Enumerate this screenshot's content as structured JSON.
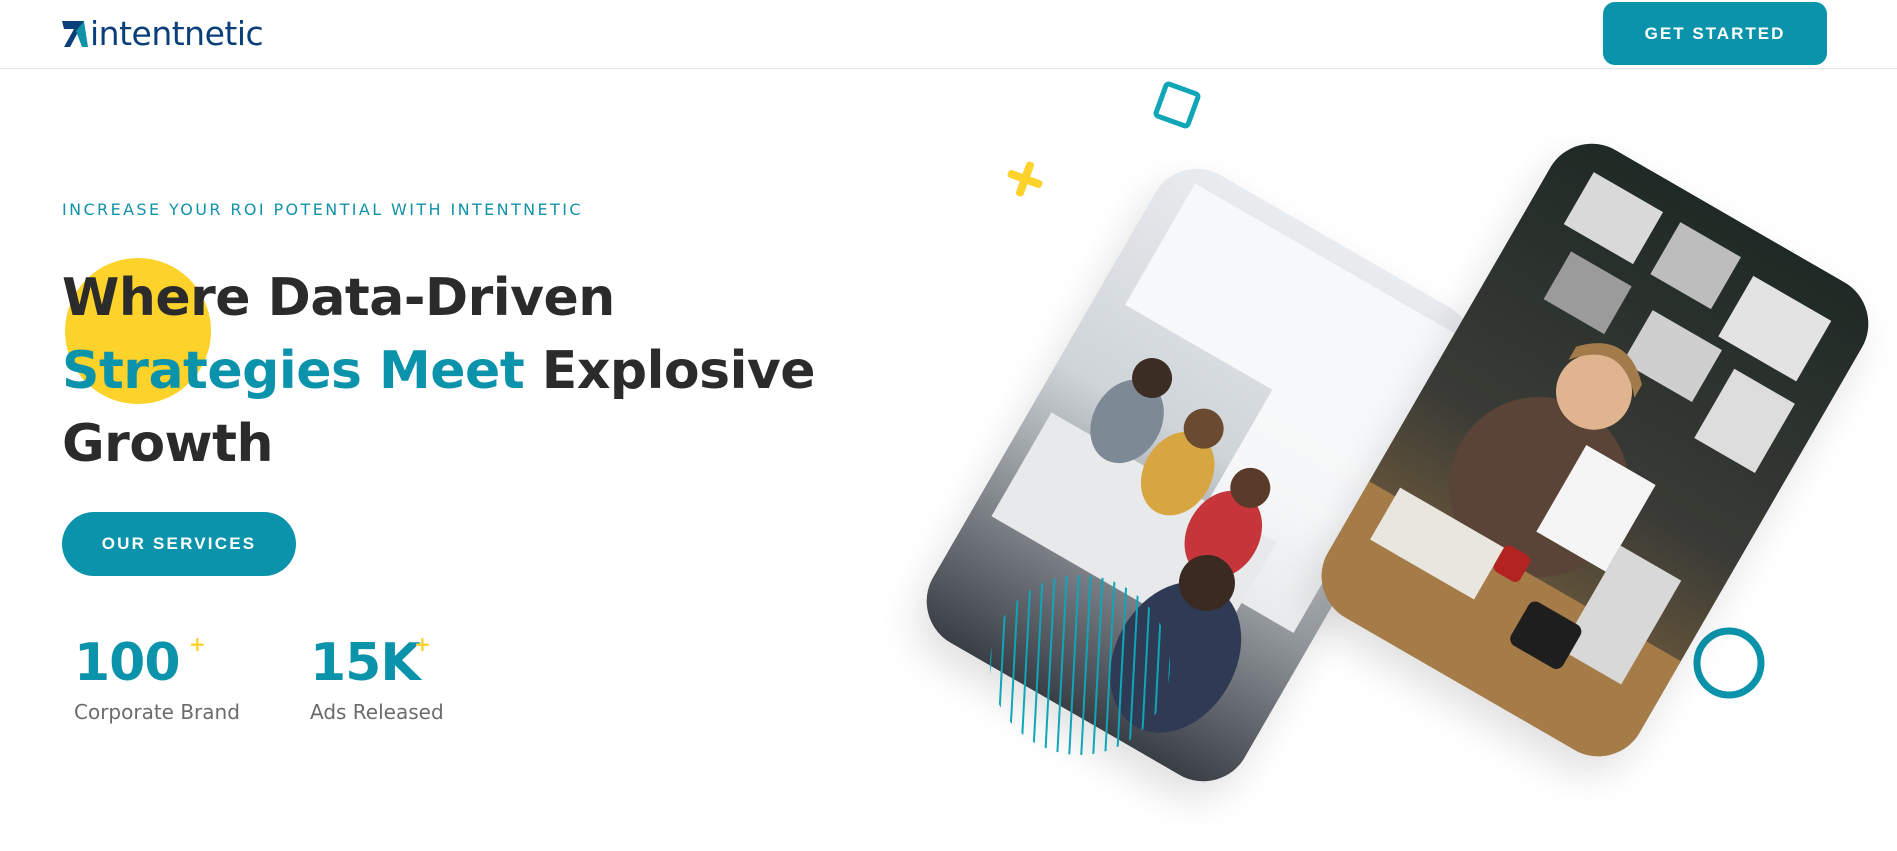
{
  "header": {
    "logo_text": "intentnetic",
    "cta_label": "GET STARTED"
  },
  "hero": {
    "tagline": "INCREASE YOUR ROI POTENTIAL WITH INTENTNETIC",
    "headline": {
      "line1": "Where Data-Driven",
      "line2_accent": "Strategies Meet",
      "line2_rest": " Explosive",
      "line3": "Growth"
    },
    "services_label": "OUR SERVICES"
  },
  "stats": [
    {
      "value": "100",
      "suffix": "+",
      "label": "Corporate Brand"
    },
    {
      "value": "15K",
      "suffix": "+",
      "label": "Ads Released"
    }
  ],
  "colors": {
    "primary": "#0a93aa",
    "accent_yellow": "#fcd22b",
    "logo_navy": "#0b3f7a",
    "text_dark": "#2b2b2b"
  },
  "images": {
    "left_photo": "team-meeting-photo",
    "right_photo": "man-working-at-desk-photo"
  }
}
